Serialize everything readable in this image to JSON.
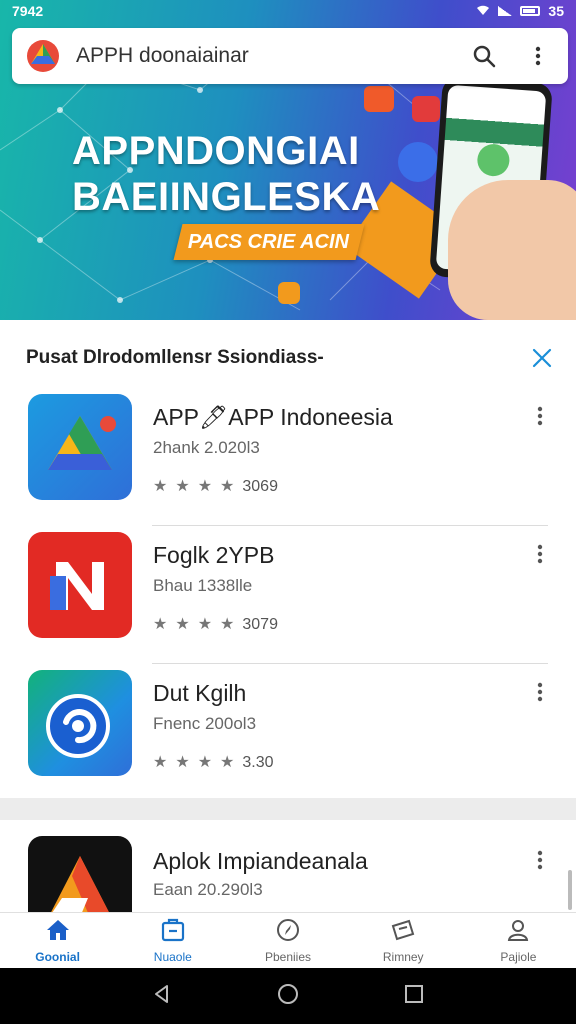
{
  "status_bar": {
    "time": "7942",
    "right_text": "35"
  },
  "search": {
    "query": "APPH doonaiainar"
  },
  "banner": {
    "title_line1": "APPNDONGIAI",
    "title_line2": "BAEIINGLESKA",
    "cta": "PACS CRIE ACIN"
  },
  "section": {
    "title": "Pusat Dlrodomllensr Ssiondiass-"
  },
  "apps": [
    {
      "name": "APP🖊APP Indoneesia",
      "subtitle": "2hank 2.020l3",
      "rating": "3069",
      "icon": "drive-style-icon"
    },
    {
      "name": "Foglk 2YPB",
      "subtitle": "Bhau 1338lle",
      "rating": "3079",
      "icon": "n-letter-icon"
    },
    {
      "name": "Dut Kgilh",
      "subtitle": "Fnenc 200ol3",
      "rating": "3.30",
      "icon": "sync-circle-icon"
    },
    {
      "name": "Aplok Impiandeanala",
      "subtitle": "Eaan 20.290l3",
      "icon": "triangle-logo-icon"
    }
  ],
  "bottom_nav": [
    {
      "label": "Goonial",
      "icon": "home-icon",
      "active": true
    },
    {
      "label": "Nuaole",
      "icon": "apps-icon",
      "active": false
    },
    {
      "label": "Pbeniies",
      "icon": "compass-icon",
      "active": false
    },
    {
      "label": "Rimney",
      "icon": "ticket-icon",
      "active": false
    },
    {
      "label": "Pajiole",
      "icon": "profile-icon",
      "active": false
    }
  ],
  "colors": {
    "accent": "#1a73c8",
    "cta": "#f29a1d",
    "close": "#1a8fd8"
  }
}
